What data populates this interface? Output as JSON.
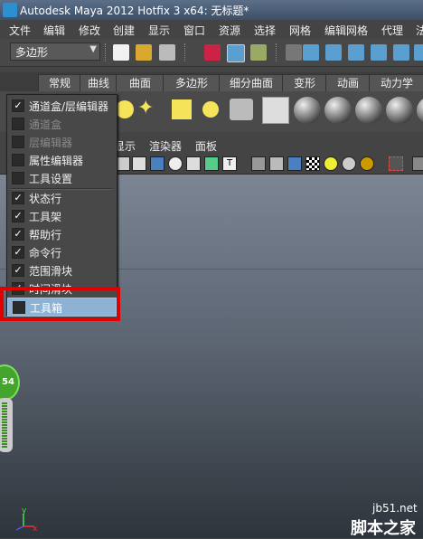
{
  "window": {
    "title": "Autodesk Maya 2012 Hotfix 3 x64: 无标题*"
  },
  "menubar": {
    "items": [
      "文件",
      "编辑",
      "修改",
      "创建",
      "显示",
      "窗口",
      "资源",
      "选择",
      "网格",
      "编辑网格",
      "代理",
      "法"
    ]
  },
  "toolbar": {
    "mode_select": "多边形"
  },
  "shelf_tabs": [
    "常规",
    "曲线",
    "曲面",
    "多边形",
    "细分曲面",
    "变形",
    "动画",
    "动力学"
  ],
  "panel_menu": {
    "items": [
      "显示",
      "渲染器",
      "面板"
    ]
  },
  "dropdown": {
    "items": [
      {
        "label": "通道盒/层编辑器",
        "checked": true,
        "enabled": true
      },
      {
        "label": "通道盒",
        "checked": false,
        "enabled": false
      },
      {
        "label": "层编辑器",
        "checked": false,
        "enabled": false
      },
      {
        "label": "属性编辑器",
        "checked": false,
        "enabled": true
      },
      {
        "label": "工具设置",
        "checked": false,
        "enabled": true
      },
      {
        "label": "状态行",
        "checked": true,
        "enabled": true
      },
      {
        "label": "工具架",
        "checked": true,
        "enabled": true
      },
      {
        "label": "帮助行",
        "checked": true,
        "enabled": true
      },
      {
        "label": "命令行",
        "checked": true,
        "enabled": true
      },
      {
        "label": "范围滑块",
        "checked": true,
        "enabled": true
      },
      {
        "label": "时间滑块",
        "checked": true,
        "enabled": true
      },
      {
        "label": "工具箱",
        "checked": false,
        "enabled": true,
        "highlighted": true
      }
    ]
  },
  "hud": {
    "value": "54"
  },
  "axis": {
    "x": "x",
    "y": "y"
  },
  "watermark": {
    "site": "jb51.net",
    "name": "脚本之家"
  },
  "colors": {
    "highlight_box": "#e00000",
    "selected_item": "#8db2d4",
    "timeline_line": "#c03030"
  }
}
